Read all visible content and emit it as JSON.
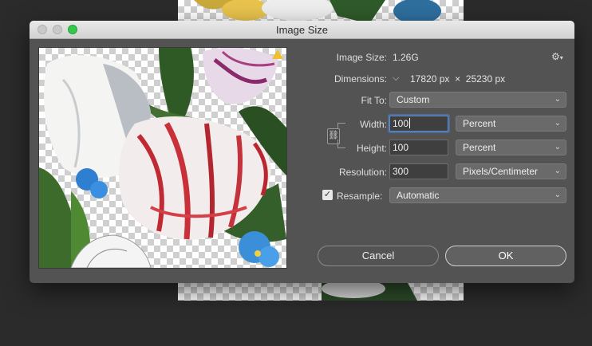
{
  "document": {
    "layer_image": "botanical tulip illustration on transparent checkerboard"
  },
  "dialog": {
    "title": "Image Size",
    "image_size": {
      "label": "Image Size:",
      "value": "1.26G"
    },
    "dimensions": {
      "label": "Dimensions:",
      "width": "17820",
      "width_unit": "px",
      "times": "×",
      "height": "25230",
      "height_unit": "px"
    },
    "fit_to": {
      "label": "Fit To:",
      "value": "Custom"
    },
    "width": {
      "label": "Width:",
      "value": "100",
      "unit": "Percent"
    },
    "height": {
      "label": "Height:",
      "value": "100",
      "unit": "Percent"
    },
    "resolution": {
      "label": "Resolution:",
      "value": "300",
      "unit": "Pixels/Centimeter"
    },
    "resample": {
      "label": "Resample:",
      "checked": true,
      "value": "Automatic"
    },
    "buttons": {
      "cancel": "Cancel",
      "ok": "OK"
    },
    "icons": {
      "gear": "gear-icon",
      "chain": "link-icon",
      "chevron": "chevron-down-icon",
      "dimension_toggle": "chevron-down-icon"
    }
  },
  "colors": {
    "dialog_bg": "#535353",
    "titlebar": "#dcdcdc",
    "focus": "#5a8fd6",
    "zoom_button": "#34c84a"
  }
}
